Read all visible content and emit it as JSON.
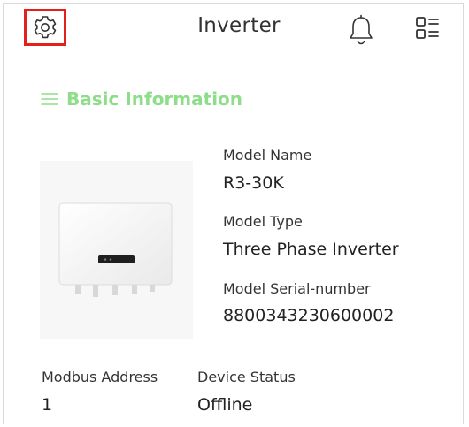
{
  "header": {
    "title": "Inverter",
    "icons": {
      "settings": "settings-icon",
      "notifications": "bell-icon",
      "menu": "menu-grid-icon"
    },
    "highlight_color": "#e3201b"
  },
  "section": {
    "title": "Basic Information",
    "icon": "list-icon",
    "accent_color": "#8fdd8a"
  },
  "info": {
    "model_name_label": "Model Name",
    "model_name_value": "R3-30K",
    "model_type_label": "Model Type",
    "model_type_value": "Three Phase Inverter",
    "serial_label": "Model Serial-number",
    "serial_value": "8800343230600002"
  },
  "bottom": {
    "modbus_label": "Modbus Address",
    "modbus_value": "1",
    "status_label": "Device Status",
    "status_value": "Offline"
  }
}
